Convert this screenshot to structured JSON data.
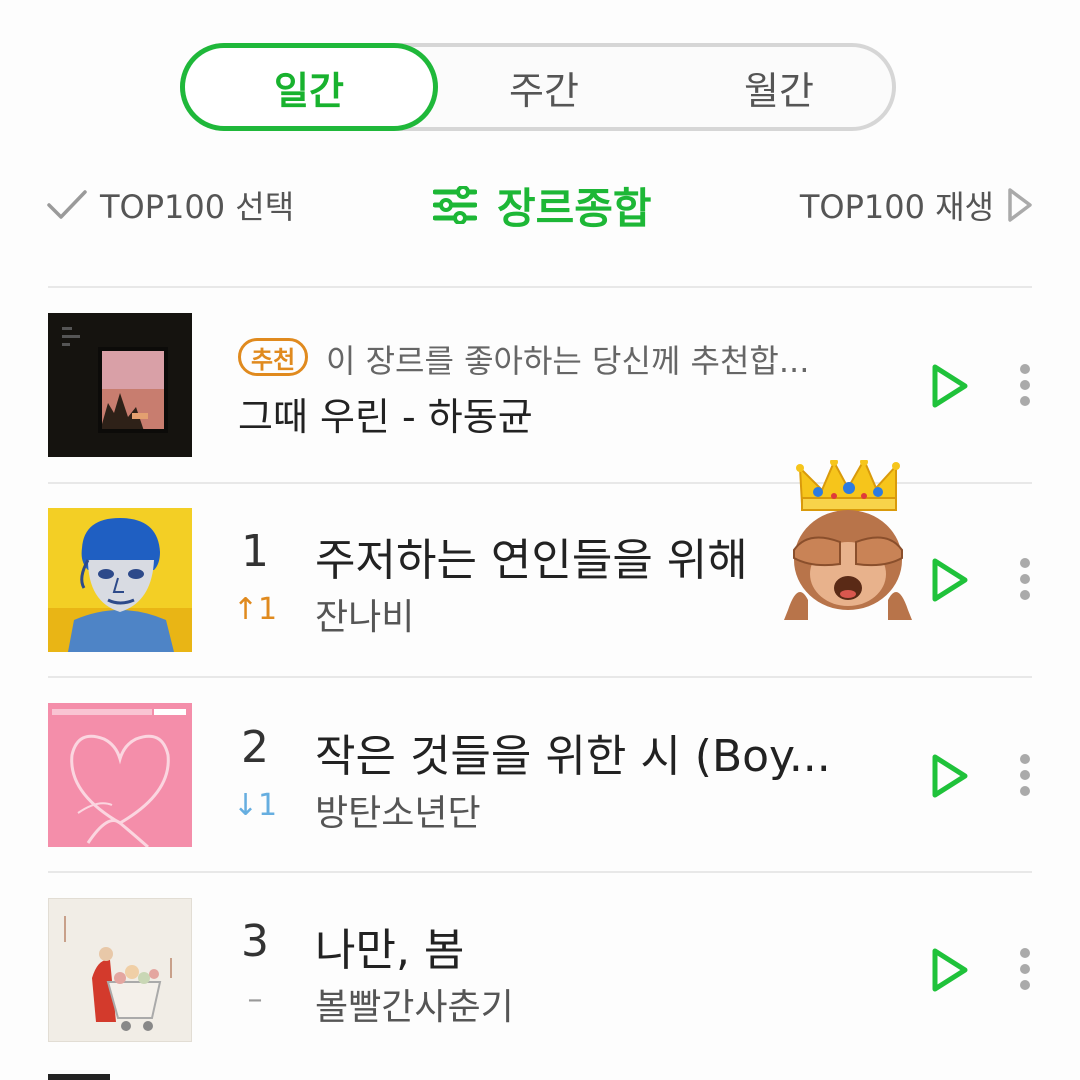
{
  "tabs": [
    {
      "label": "일간",
      "active": true
    },
    {
      "label": "주간",
      "active": false
    },
    {
      "label": "월간",
      "active": false
    }
  ],
  "toolbar": {
    "select_label": "TOP100 선택",
    "genre_label": "장르종합",
    "play_all_label": "TOP100 재생"
  },
  "recommendation": {
    "badge": "추천",
    "text": "이 장르를 좋아하는 당신께 추천합...",
    "song": "그때 우린 - 하동균"
  },
  "chart": [
    {
      "rank": "1",
      "change": "↑1",
      "title": "주저하는 연인들을 위해",
      "artist": "잔나비"
    },
    {
      "rank": "2",
      "change": "↓1",
      "title": "작은 것들을 위한 시 (Boy...",
      "artist": "방탄소년단"
    },
    {
      "rank": "3",
      "change": "–",
      "title": "나만, 봄",
      "artist": "볼빨간사춘기"
    }
  ],
  "colors": {
    "accent_green": "#1db736",
    "rank_up": "#e08a1e",
    "rank_down": "#66aee0"
  }
}
